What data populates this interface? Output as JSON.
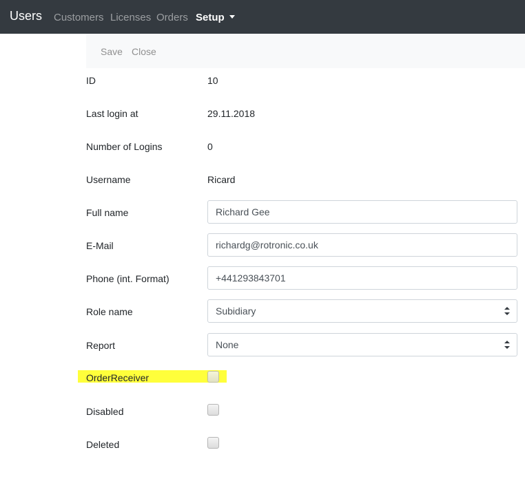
{
  "navbar": {
    "brand": "Users",
    "links": [
      "Customers",
      "Licenses",
      "Orders"
    ],
    "active_dropdown": "Setup"
  },
  "toolbar": {
    "save_label": "Save",
    "close_label": "Close"
  },
  "fields": {
    "id": {
      "label": "ID",
      "value": "10"
    },
    "last_login": {
      "label": "Last login at",
      "value": "29.11.2018"
    },
    "num_logins": {
      "label": "Number of Logins",
      "value": "0"
    },
    "username": {
      "label": "Username",
      "value": "Ricard"
    },
    "full_name": {
      "label": "Full name",
      "value": "Richard Gee"
    },
    "email": {
      "label": "E-Mail",
      "value": "richardg@rotronic.co.uk"
    },
    "phone": {
      "label": "Phone (int. Format)",
      "value": "+441293843701"
    },
    "role_name": {
      "label": "Role name",
      "selected": "Subidiary"
    },
    "report": {
      "label": "Report",
      "selected": "None"
    },
    "order_receiver": {
      "label": "OrderReceiver",
      "checked": false
    },
    "disabled": {
      "label": "Disabled",
      "checked": false
    },
    "deleted": {
      "label": "Deleted",
      "checked": false
    }
  },
  "colors": {
    "navbar_bg": "#343a40",
    "toolbar_bg": "#f8f9fa",
    "highlight": "#ffff3b"
  }
}
